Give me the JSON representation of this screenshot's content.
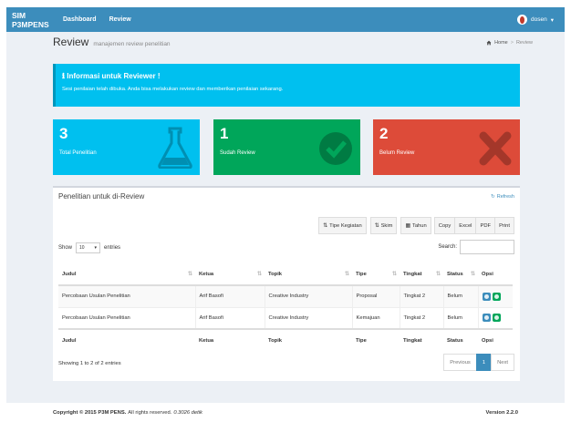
{
  "navbar": {
    "brand": "SIM P3MPENS",
    "links": [
      "Dashboard",
      "Review"
    ],
    "user": "dosen"
  },
  "header": {
    "title": "Review",
    "subtitle": "manajemen review penelitian",
    "breadcrumb": [
      "Home",
      "Review"
    ]
  },
  "callout": {
    "title": "Informasi untuk Reviewer !",
    "text": "Sesi penilaian telah dibuka. Anda bisa melakukan review dan memberikan penilaian sekarang."
  },
  "stats": [
    {
      "value": "3",
      "label": "Total Penelitian",
      "icon": "flask-icon",
      "color": "#00c0ef"
    },
    {
      "value": "1",
      "label": "Sudah Review",
      "icon": "check-circle-icon",
      "color": "#00a65a"
    },
    {
      "value": "2",
      "label": "Belum Review",
      "icon": "times-icon",
      "color": "#dd4b39"
    }
  ],
  "box": {
    "title": "Penelitian untuk di-Review",
    "refresh": "Refresh",
    "filters": [
      "Tipe Kegiatan",
      "Skim",
      "Tahun"
    ],
    "exports": [
      "Copy",
      "Excel",
      "PDF",
      "Print"
    ],
    "show_prefix": "Show",
    "show_value": "10",
    "show_suffix": "entries",
    "search_label": "Search:",
    "columns": [
      "Judul",
      "Ketua",
      "Topik",
      "Tipe",
      "Tingkat",
      "Status",
      "Opsi"
    ],
    "rows": [
      [
        "Percobaan Usulan Penelitian",
        "Arif Basofi",
        "Creative Industry",
        "Proposal",
        "Tingkat 2",
        "Belum"
      ],
      [
        "Percobaan Usulan Penelitian",
        "Arif Basofi",
        "Creative Industry",
        "Kemajuan",
        "Tingkat 2",
        "Belum"
      ]
    ],
    "info": "Showing 1 to 2 of 2 entries",
    "pager": [
      "Previous",
      "1",
      "Next"
    ]
  },
  "footer": {
    "copyright": "Copyright © 2015 P3M PENS.",
    "rights": "All rights reserved.",
    "time": "0.3026 detik",
    "version": "Version 2.2.0"
  }
}
